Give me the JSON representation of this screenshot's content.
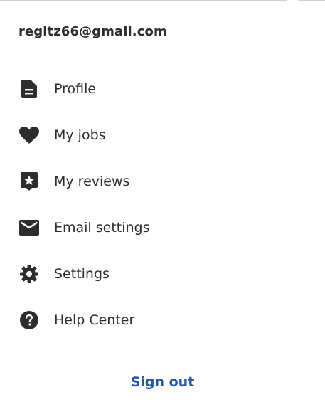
{
  "account": {
    "email": "regitz66@gmail.com"
  },
  "menu": {
    "items": [
      {
        "label": "Profile",
        "icon": "document-icon"
      },
      {
        "label": "My jobs",
        "icon": "heart-icon"
      },
      {
        "label": "My reviews",
        "icon": "star-review-icon"
      },
      {
        "label": "Email settings",
        "icon": "envelope-icon"
      },
      {
        "label": "Settings",
        "icon": "gear-icon"
      },
      {
        "label": "Help Center",
        "icon": "question-circle-icon"
      }
    ]
  },
  "footer": {
    "sign_out_label": "Sign out"
  },
  "colors": {
    "text": "#2d2d2d",
    "link": "#2557a7",
    "divider": "#d4d2d0"
  }
}
